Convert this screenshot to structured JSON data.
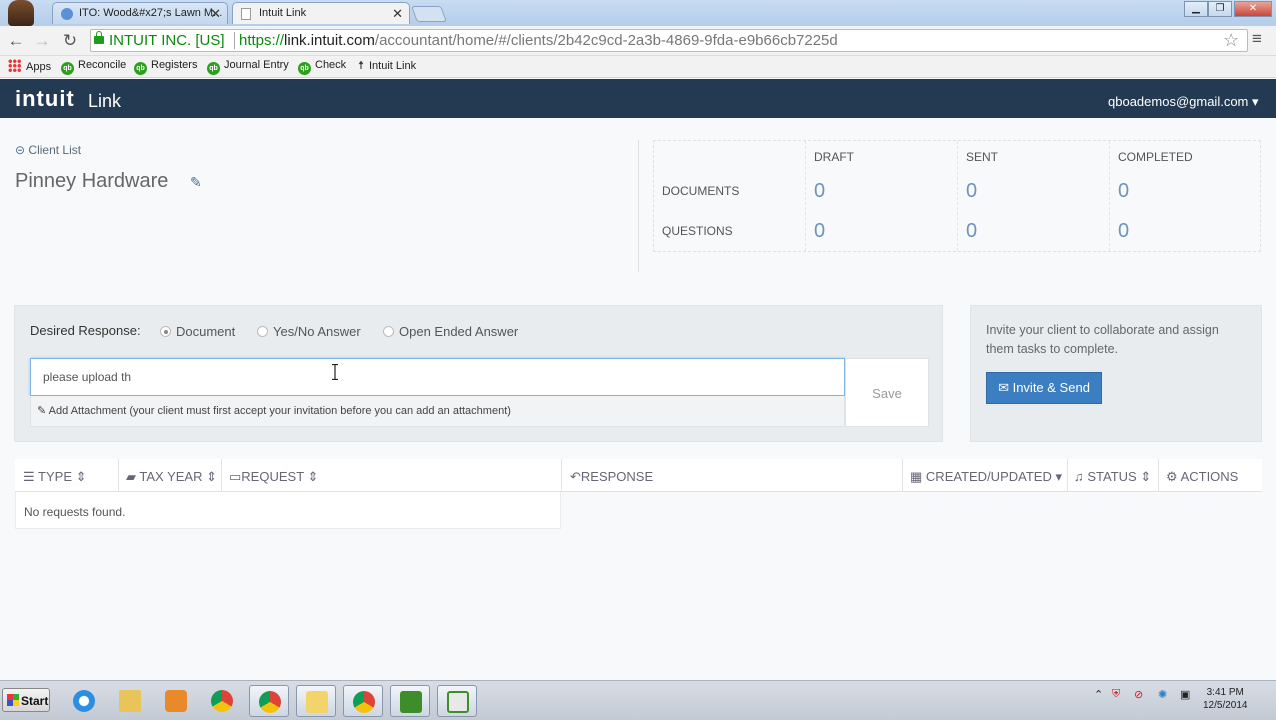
{
  "browser": {
    "tabs": [
      {
        "title": "ITO: Wood&#x27;s Lawn M..."
      },
      {
        "title": "Intuit Link"
      }
    ],
    "ev_label": "INTUIT INC. [US]",
    "url_scheme": "https://",
    "url_host": "link.intuit.com",
    "url_path": "/accountant/home/#/clients/2b42c9cd-2a3b-4869-9fda-e9b66cb7225d",
    "bookmarks": [
      "Apps",
      "Reconcile",
      "Registers",
      "Journal Entry",
      "Check",
      "Intuit Link"
    ]
  },
  "header": {
    "logo": "intuit",
    "product": "Link",
    "user_email": "qboademos@gmail.com"
  },
  "client": {
    "back_label": "Client List",
    "name": "Pinney Hardware"
  },
  "stats": {
    "columns": [
      "DRAFT",
      "SENT",
      "COMPLETED"
    ],
    "rows": [
      {
        "label": "DOCUMENTS",
        "values": [
          "0",
          "0",
          "0"
        ]
      },
      {
        "label": "QUESTIONS",
        "values": [
          "0",
          "0",
          "0"
        ]
      }
    ]
  },
  "request": {
    "desired_label": "Desired Response:",
    "options": [
      "Document",
      "Yes/No Answer",
      "Open Ended Answer"
    ],
    "selected": "Document",
    "input_value": "please upload th",
    "attachment_text": "Add Attachment (your client must first accept your invitation before you can add an attachment)",
    "save_label": "Save"
  },
  "invite": {
    "text": "Invite your client to collaborate and assign them tasks to complete.",
    "button_label": "Invite & Send"
  },
  "table": {
    "headers": [
      "TYPE",
      "TAX YEAR",
      "REQUEST",
      "RESPONSE",
      "CREATED/UPDATED",
      "STATUS",
      "ACTIONS"
    ],
    "empty_message": "No requests found."
  },
  "taskbar": {
    "start_label": "Start",
    "time": "3:41 PM",
    "date": "12/5/2014"
  }
}
